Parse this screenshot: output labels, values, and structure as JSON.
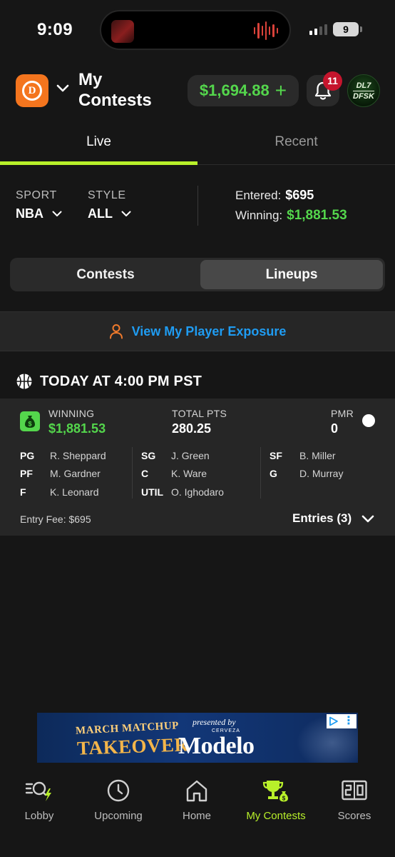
{
  "status_bar": {
    "time": "9:09",
    "battery": "9"
  },
  "header": {
    "title_line1": "My",
    "title_line2": "Contests",
    "balance": "$1,694.88",
    "balance_add": "+",
    "notifications_count": "11",
    "avatar_line1": "DL7",
    "avatar_line2": "DFSK"
  },
  "tabs": [
    {
      "label": "Live",
      "active": true
    },
    {
      "label": "Recent",
      "active": false
    }
  ],
  "filters": {
    "sport_label": "SPORT",
    "sport_value": "NBA",
    "style_label": "STYLE",
    "style_value": "ALL"
  },
  "summary": {
    "entered_label": "Entered:",
    "entered_value": "$695",
    "winning_label": "Winning:",
    "winning_value": "$1,881.53"
  },
  "segmented": {
    "contests": "Contests",
    "lineups": "Lineups",
    "selected": "Lineups"
  },
  "exposure": {
    "label": "View My Player Exposure"
  },
  "contest_group": {
    "title": "TODAY AT 4:00 PM PST",
    "card": {
      "winning_label": "WINNING",
      "winning_value": "$1,881.53",
      "total_pts_label": "TOTAL PTS",
      "total_pts_value": "280.25",
      "pmr_label": "PMR",
      "pmr_value": "0",
      "lineup": [
        {
          "pos": "PG",
          "name": "R. Sheppard"
        },
        {
          "pos": "PF",
          "name": "M. Gardner"
        },
        {
          "pos": "F",
          "name": "K. Leonard"
        },
        {
          "pos": "SG",
          "name": "J. Green"
        },
        {
          "pos": "C",
          "name": "K. Ware"
        },
        {
          "pos": "UTIL",
          "name": "O. Ighodaro"
        },
        {
          "pos": "SF",
          "name": "B. Miller"
        },
        {
          "pos": "G",
          "name": "D. Murray"
        }
      ],
      "entry_fee": "Entry Fee: $695",
      "entries": "Entries (3)"
    }
  },
  "ad": {
    "line1": "MARCH MATCHUP",
    "line2": "TAKEOVER",
    "presented_by": "presented by",
    "cerveza": "CERVEZA",
    "brand": "Modelo"
  },
  "bottom_nav": [
    {
      "label": "Lobby",
      "icon": "lobby-search-bolt-icon",
      "active": false
    },
    {
      "label": "Upcoming",
      "icon": "clock-icon",
      "active": false
    },
    {
      "label": "Home",
      "icon": "home-icon",
      "active": false
    },
    {
      "label": "My Contests",
      "icon": "trophy-money-icon",
      "active": true
    },
    {
      "label": "Scores",
      "icon": "scoreboard-icon",
      "active": false
    }
  ],
  "colors": {
    "accent_green": "#54d64c",
    "tab_underline": "#b8f02a",
    "link_blue": "#1f9cf2",
    "brand_orange": "#f4751e",
    "badge_red": "#c5152d"
  }
}
